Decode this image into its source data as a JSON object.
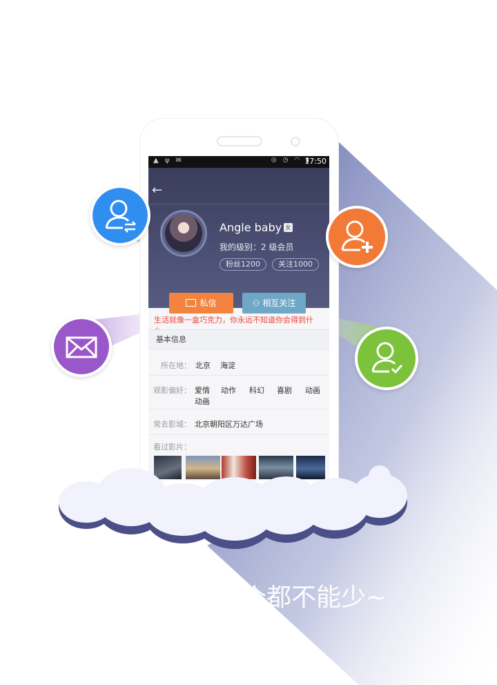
{
  "status_bar": {
    "time": "17:50"
  },
  "profile": {
    "name": "Angle baby",
    "gender": "女",
    "level": "我的级别：2 级会员",
    "fans": "粉丝1200",
    "following": "关注1000"
  },
  "actions": {
    "message": "私信",
    "mutual_follow": "相互关注"
  },
  "motto": "生活就像一盒巧克力，你永远不知道你会得到什么。",
  "info": {
    "header": "基本信息",
    "location_label": "所在地：",
    "location_city": "北京",
    "location_district": "海淀",
    "genre_label": "观影偏好：",
    "genres": [
      "爱情",
      "动作",
      "科幻",
      "喜剧",
      "动画",
      "动画"
    ],
    "cinema_label": "常去影城：",
    "cinema": "北京朝阳区万达广场",
    "watched_label": "看过影片："
  },
  "caption": "个都不能少~",
  "colors": {
    "blue": "#2f8ef0",
    "orange": "#f37a36",
    "purple": "#9a57c9",
    "green": "#7cc23a",
    "message_button": "#f2843f",
    "mutual_button": "#6fa8c6",
    "motto_text": "#e8473b"
  },
  "icons": {
    "blue": "user-swap-icon",
    "orange": "user-add-icon",
    "purple": "envelope-icon",
    "green": "user-check-icon"
  }
}
